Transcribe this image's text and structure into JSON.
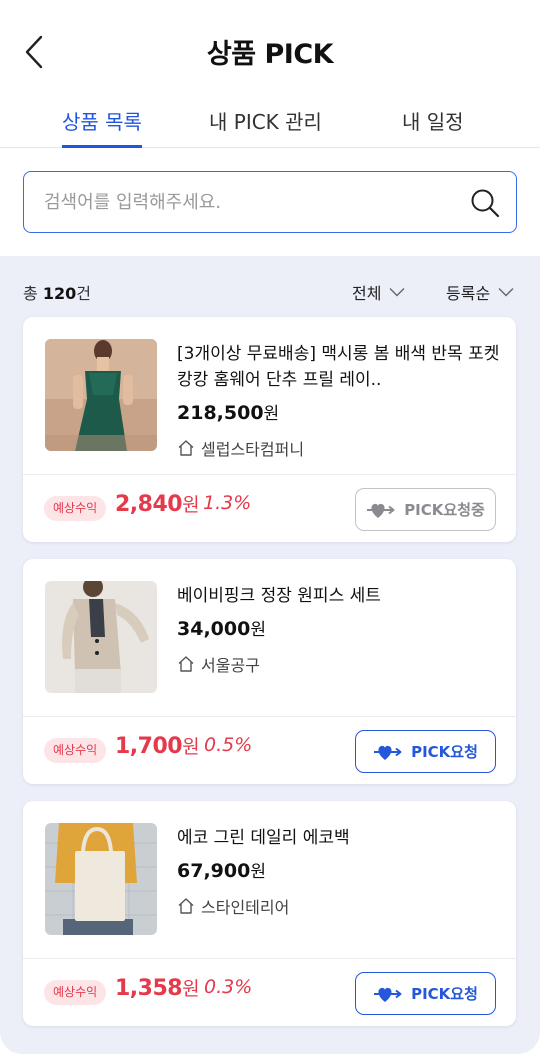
{
  "header": {
    "title": "상품 PICK"
  },
  "tabs": [
    {
      "label": "상품 목록"
    },
    {
      "label": "내 PICK 관리"
    },
    {
      "label": "내 일정"
    }
  ],
  "search": {
    "placeholder": "검색어를 입력해주세요."
  },
  "list": {
    "count_prefix": "총 ",
    "count_value": "120",
    "count_suffix": "건",
    "filter_all": "전체",
    "sort": "등록순"
  },
  "products": [
    {
      "name": "[3개이상 무료배송] 맥시롱 봄 배색 반목 포켓 캉캉 홈웨어 단추 프릴 레이..",
      "price": "218,500",
      "won": "원",
      "shop": "셀럽스타컴퍼니",
      "badge": "예상수익",
      "earn": "2,840",
      "rate": "1.3%",
      "button": "PICK요청중",
      "status": "pending"
    },
    {
      "name": "베이비핑크 정장 원피스 세트",
      "price": "34,000",
      "won": "원",
      "shop": "서울공구",
      "badge": "예상수익",
      "earn": "1,700",
      "rate": "0.5%",
      "button": "PICK요청",
      "status": "request"
    },
    {
      "name": "에코 그린 데일리 에코백",
      "price": "67,900",
      "won": "원",
      "shop": "스타인테리어",
      "badge": "예상수익",
      "earn": "1,358",
      "rate": "0.3%",
      "button": "PICK요청",
      "status": "request"
    }
  ],
  "colors": {
    "accent": "#1f56e0",
    "earn": "#e5394c",
    "list_bg": "#eceff8",
    "pending": "#8a8a90"
  },
  "icons": {
    "back": "chevron-left-icon",
    "search": "search-icon",
    "dropdown": "chevron-down-icon",
    "shop": "home-icon",
    "pick": "heart-arrow-icon"
  }
}
